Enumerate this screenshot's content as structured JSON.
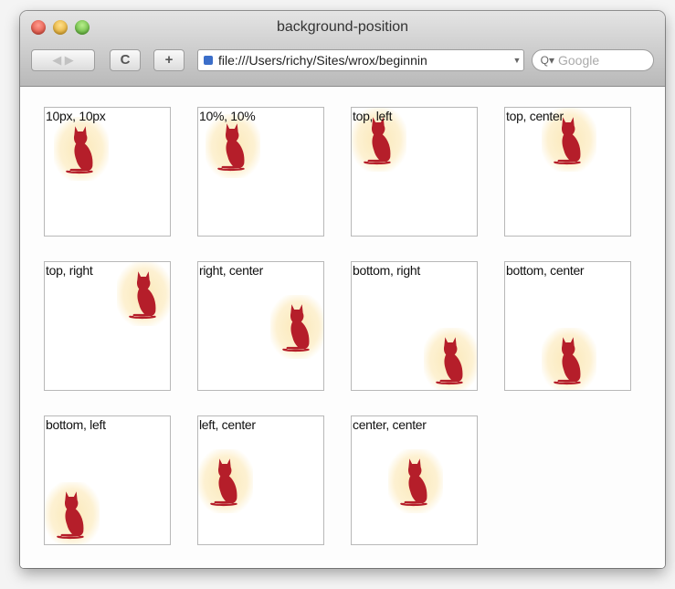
{
  "window": {
    "title": "background-position",
    "back_forward_label": "◀ ▶",
    "reload_label": "C",
    "add_label": "+",
    "address": "file:///Users/richy/Sites/wrox/beginnin",
    "address_dropdown": "▼",
    "search_icon_glyph": "Q▾",
    "search_placeholder": "Google"
  },
  "boxes": [
    {
      "label": "10px, 10px",
      "position": "10px 10px"
    },
    {
      "label": "10%, 10%",
      "position": "10% 10%"
    },
    {
      "label": "top, left",
      "position": "top left"
    },
    {
      "label": "top, center",
      "position": "top center"
    },
    {
      "label": "top, right",
      "position": "top right"
    },
    {
      "label": "right, center",
      "position": "right center"
    },
    {
      "label": "bottom, right",
      "position": "bottom right"
    },
    {
      "label": "bottom, center",
      "position": "bottom center"
    },
    {
      "label": "bottom, left",
      "position": "bottom left"
    },
    {
      "label": "left, center",
      "position": "left center"
    },
    {
      "label": "center, center",
      "position": "center center"
    }
  ],
  "colors": {
    "cat": "#b51e2a",
    "glow": "#fbe8b8"
  }
}
